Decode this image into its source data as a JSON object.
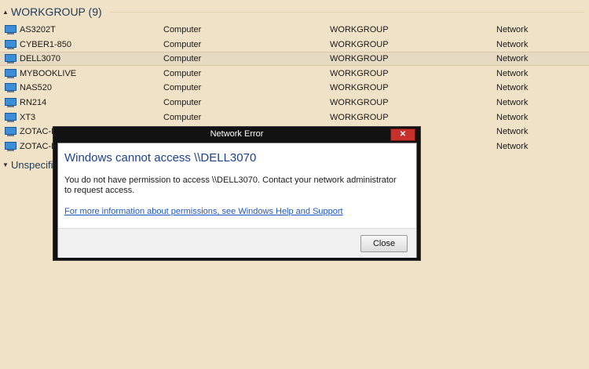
{
  "group": {
    "title": "WORKGROUP (9)"
  },
  "rows": [
    {
      "name": "AS3202T",
      "category": "Computer",
      "workgroup": "WORKGROUP",
      "network": "Network"
    },
    {
      "name": "CYBER1-850",
      "category": "Computer",
      "workgroup": "WORKGROUP",
      "network": "Network"
    },
    {
      "name": "DELL3070",
      "category": "Computer",
      "workgroup": "WORKGROUP",
      "network": "Network",
      "selected": true
    },
    {
      "name": "MYBOOKLIVE",
      "category": "Computer",
      "workgroup": "WORKGROUP",
      "network": "Network"
    },
    {
      "name": "NAS520",
      "category": "Computer",
      "workgroup": "WORKGROUP",
      "network": "Network"
    },
    {
      "name": "RN214",
      "category": "Computer",
      "workgroup": "WORKGROUP",
      "network": "Network"
    },
    {
      "name": "XT3",
      "category": "Computer",
      "workgroup": "WORKGROUP",
      "network": "Network"
    },
    {
      "name": "ZOTAC-K",
      "category": "",
      "workgroup": "",
      "network": "Network"
    },
    {
      "name": "ZOTAC-K",
      "category": "",
      "workgroup": "",
      "network": "Network"
    }
  ],
  "group2": {
    "title": "Unspecifi"
  },
  "dialog": {
    "title": "Network Error",
    "close_glyph": "✕",
    "heading": "Windows cannot access \\\\DELL3070",
    "message": "You do not have permission to access \\\\DELL3070. Contact your network administrator to request access.",
    "link": "For more information about permissions, see Windows Help and Support",
    "close_button": "Close"
  },
  "icons": {
    "chevron_up": "▲",
    "chevron_down": "▼",
    "row_icon": "computer-icon"
  }
}
